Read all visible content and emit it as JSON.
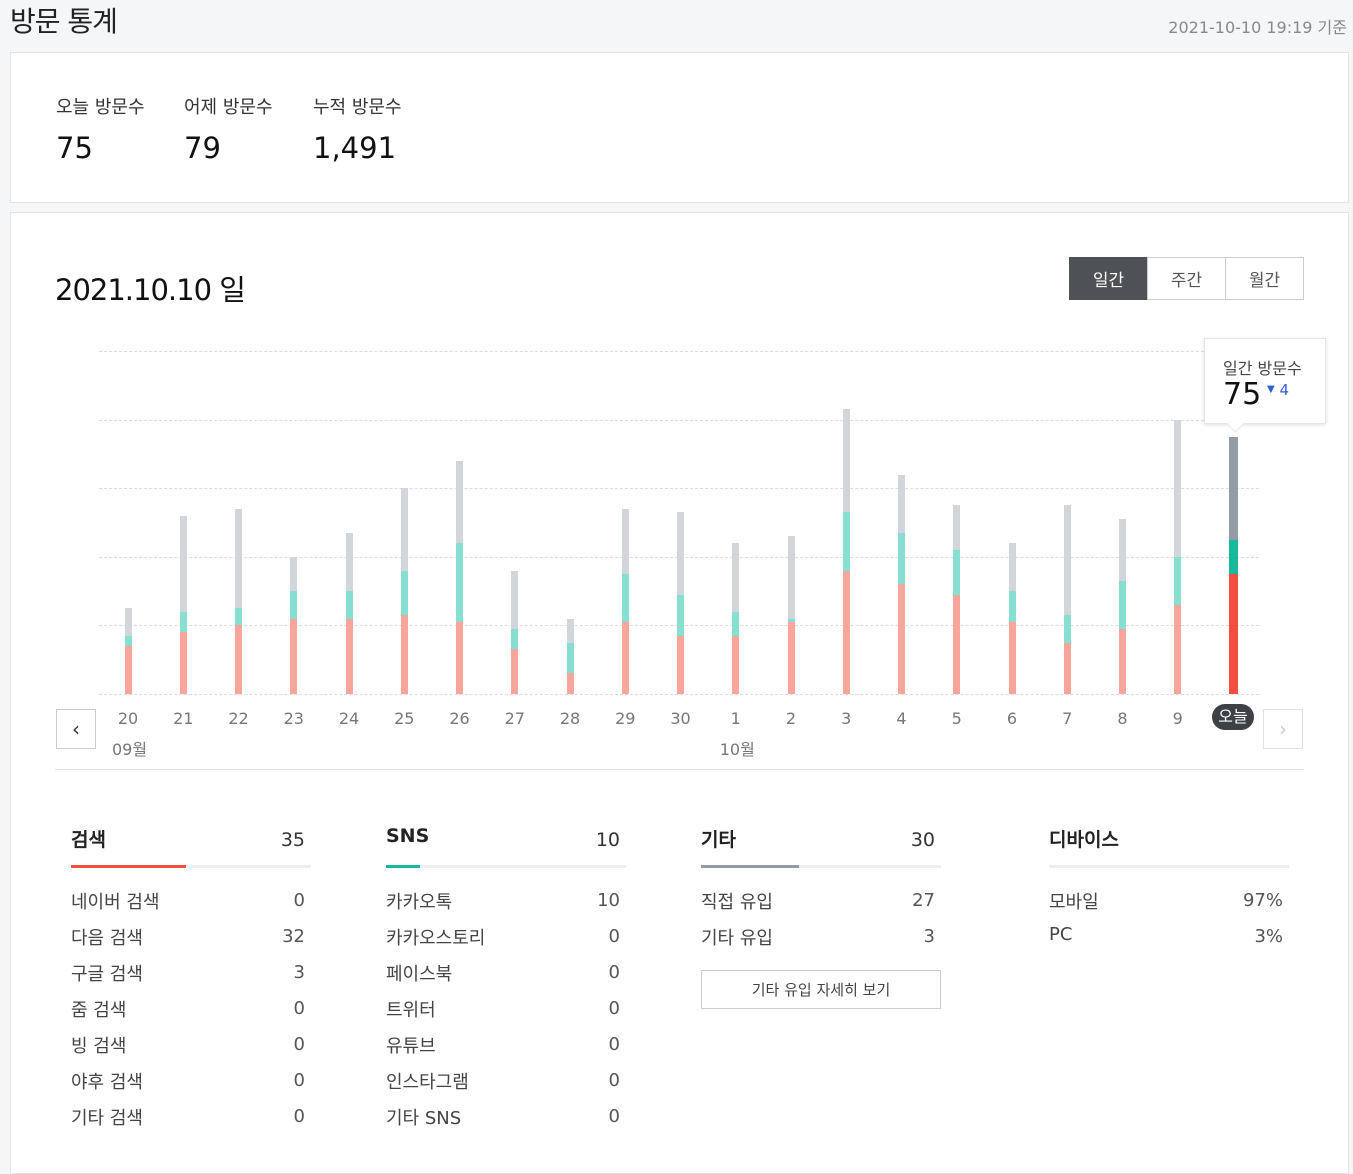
{
  "header": {
    "title": "방문 통계",
    "as_of": "2021-10-10 19:19 기준"
  },
  "summary": [
    {
      "label": "오늘 방문수",
      "value": "75"
    },
    {
      "label": "어제 방문수",
      "value": "79"
    },
    {
      "label": "누적 방문수",
      "value": "1,491"
    }
  ],
  "chart_header": {
    "date": "2021.10.10 일"
  },
  "period_tabs": [
    "일간",
    "주간",
    "월간"
  ],
  "active_tab": "일간",
  "tooltip": {
    "label": "일간 방문수",
    "value": "75",
    "delta": "4"
  },
  "colors": {
    "search": "#f8a59b",
    "sns": "#86dfd0",
    "other": "#d2d6db",
    "search_today": "#f24e42",
    "sns_today": "#18b99b",
    "other_today": "#959ba4"
  },
  "chart_data": {
    "type": "bar",
    "stacked": true,
    "categories": [
      "20",
      "21",
      "22",
      "23",
      "24",
      "25",
      "26",
      "27",
      "28",
      "29",
      "30",
      "1",
      "2",
      "3",
      "4",
      "5",
      "6",
      "7",
      "8",
      "9",
      "오늘"
    ],
    "month_labels": [
      {
        "text": "09월",
        "at": "20"
      },
      {
        "text": "10월",
        "at": "1"
      }
    ],
    "series": [
      {
        "name": "검색",
        "values": [
          14,
          18,
          20,
          22,
          22,
          23,
          21,
          13,
          6,
          21,
          17,
          17,
          21,
          36,
          32,
          29,
          21,
          15,
          19,
          26,
          35
        ]
      },
      {
        "name": "SNS",
        "values": [
          3,
          6,
          5,
          8,
          8,
          13,
          23,
          6,
          9,
          14,
          12,
          7,
          1,
          17,
          15,
          13,
          9,
          8,
          14,
          14,
          10
        ]
      },
      {
        "name": "기타",
        "values": [
          8,
          28,
          29,
          10,
          17,
          24,
          24,
          17,
          7,
          19,
          24,
          20,
          24,
          30,
          17,
          13,
          14,
          32,
          18,
          40,
          30
        ]
      }
    ],
    "ylim": [
      0,
      100
    ],
    "grid": true
  },
  "sections": [
    {
      "title": "검색",
      "total": "35",
      "fill": 0.48,
      "color": "#f24e42",
      "rows": [
        {
          "label": "네이버 검색",
          "value": "0"
        },
        {
          "label": "다음 검색",
          "value": "32"
        },
        {
          "label": "구글 검색",
          "value": "3"
        },
        {
          "label": "줌 검색",
          "value": "0"
        },
        {
          "label": "빙 검색",
          "value": "0"
        },
        {
          "label": "야후 검색",
          "value": "0"
        },
        {
          "label": "기타 검색",
          "value": "0"
        }
      ]
    },
    {
      "title": "SNS",
      "total": "10",
      "fill": 0.14,
      "color": "#18b99b",
      "rows": [
        {
          "label": "카카오톡",
          "value": "10"
        },
        {
          "label": "카카오스토리",
          "value": "0"
        },
        {
          "label": "페이스북",
          "value": "0"
        },
        {
          "label": "트위터",
          "value": "0"
        },
        {
          "label": "유튜브",
          "value": "0"
        },
        {
          "label": "인스타그램",
          "value": "0"
        },
        {
          "label": "기타 SNS",
          "value": "0"
        }
      ]
    },
    {
      "title": "기타",
      "total": "30",
      "fill": 0.41,
      "color": "#959ba4",
      "rows": [
        {
          "label": "직접 유입",
          "value": "27"
        },
        {
          "label": "기타 유입",
          "value": "3"
        }
      ],
      "button": "기타 유입 자세히 보기"
    },
    {
      "title": "디바이스",
      "total": "",
      "fill": 0,
      "rows": [
        {
          "label": "모바일",
          "value": "97%"
        },
        {
          "label": "PC",
          "value": "3%"
        }
      ]
    }
  ]
}
